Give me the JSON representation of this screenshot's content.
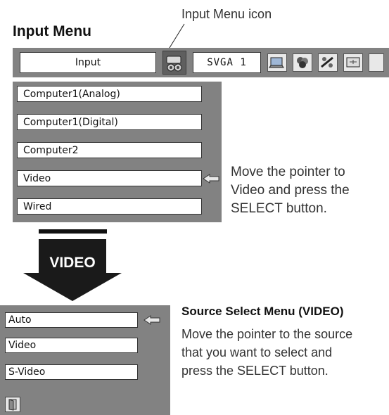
{
  "callout": {
    "label": "Input Menu icon"
  },
  "heading": "Input Menu",
  "menubar": {
    "input_label": "Input",
    "source_label": "SVGA 1",
    "icons": [
      "input-menu-icon",
      "screen-icon",
      "color-icon",
      "adjust-icon",
      "setting-icon"
    ]
  },
  "input_list": {
    "items": [
      "Computer1(Analog)",
      "Computer1(Digital)",
      "Computer2",
      "Video",
      "Wired"
    ],
    "pointer_on": "Video"
  },
  "instruction1": [
    "Move the pointer to",
    "Video and press the",
    "SELECT button."
  ],
  "transition_label": "VIDEO",
  "source_select": {
    "title": "Source Select Menu (VIDEO)",
    "items": [
      "Auto",
      "Video",
      "S-Video"
    ],
    "pointer_on": "Auto"
  },
  "instruction2": [
    "Move the pointer to the source",
    "that you want to select and",
    "press the SELECT button."
  ],
  "colors": {
    "panel_gray": "#828282",
    "item_bg": "#ffffff",
    "text": "#333333"
  }
}
